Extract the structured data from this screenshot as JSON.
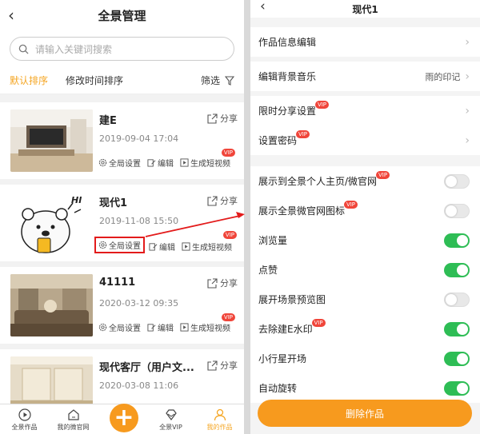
{
  "left": {
    "title": "全景管理",
    "search_placeholder": "请输入关键词搜索",
    "sort_default": "默认排序",
    "sort_time": "修改时间排序",
    "filter": "筛选",
    "share_label": "分享",
    "actions": {
      "global": "全局设置",
      "edit": "编辑",
      "video": "生成短视频"
    },
    "vip": "VIP",
    "items": [
      {
        "title": "建E",
        "date": "2019-09-04 17:04"
      },
      {
        "title": "现代1",
        "date": "2019-11-08 15:50"
      },
      {
        "title": "41111",
        "date": "2020-03-12 09:35"
      },
      {
        "title": "现代客厅（用户文...",
        "date": "2020-03-08 11:06"
      }
    ],
    "tabs": [
      {
        "label": "全景作品",
        "icon": "play-circle-icon"
      },
      {
        "label": "我的微官网",
        "icon": "home-icon"
      },
      {
        "label": "",
        "icon": "plus-icon"
      },
      {
        "label": "全景VIP",
        "icon": "diamond-icon"
      },
      {
        "label": "我的作品",
        "icon": "user-icon"
      }
    ],
    "bubble_text": "HI"
  },
  "right": {
    "title": "现代1",
    "rows": [
      {
        "label": "作品信息编辑"
      },
      {
        "label": "编辑背景音乐",
        "value": "雨的印记"
      },
      {
        "label": "限时分享设置",
        "vip": true
      },
      {
        "label": "设置密码",
        "vip": true
      }
    ],
    "toggles": [
      {
        "label": "展示到全景个人主页/微官网",
        "vip": true,
        "on": false
      },
      {
        "label": "展示全景微官网图标",
        "vip": true,
        "on": false
      },
      {
        "label": "浏览量",
        "on": true
      },
      {
        "label": "点赞",
        "on": true
      },
      {
        "label": "展开场景预览图",
        "on": false
      },
      {
        "label": "去除建E水印",
        "vip": true,
        "on": true
      },
      {
        "label": "小行星开场",
        "on": true
      },
      {
        "label": "自动旋转",
        "on": true
      }
    ],
    "delete_label": "删除作品"
  },
  "colors": {
    "accent": "#f79a1e",
    "toggle_on": "#2ebd55",
    "vip": "#f0453a",
    "highlight": "#e31b1b"
  }
}
